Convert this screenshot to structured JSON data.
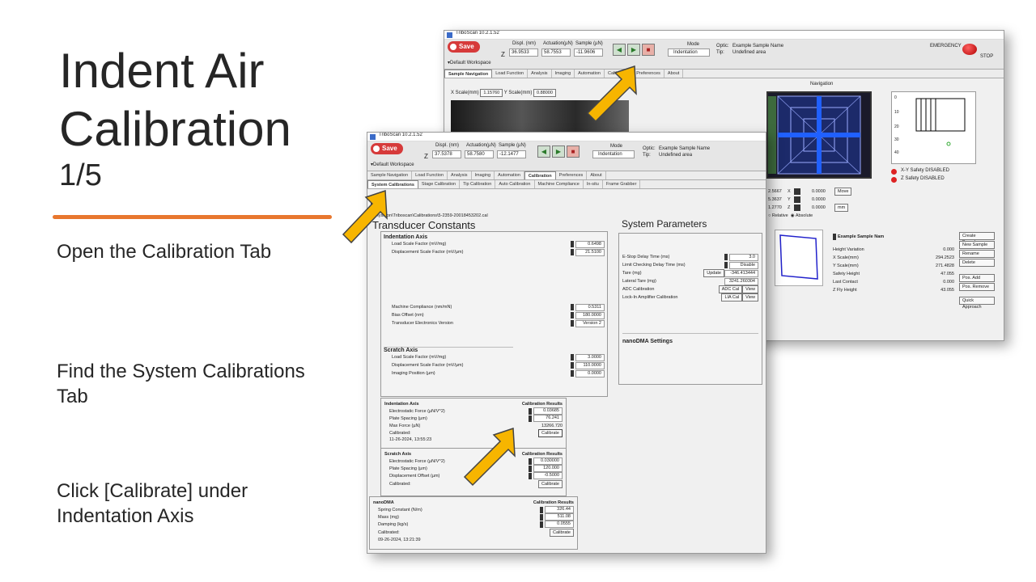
{
  "slide": {
    "title_line1": "Indent Air",
    "title_line2": "Calibration",
    "step": "1/5",
    "instructions": [
      "Open the Calibration Tab",
      "Find the System Calibrations Tab",
      "Click [Calibrate] under Indentation Axis"
    ],
    "accent_color": "#e8772e"
  },
  "back_window": {
    "app_title": "TriboScan 10.2.1.52",
    "save_label": "Save",
    "z_label": "Z",
    "displ_label": "Displ. (nm)",
    "displ_value": "36.9533",
    "actuation_label": "Actuation(µN)",
    "actuation_value": "58.7553",
    "sample_label": "Sample (µN)",
    "sample_value": "-11.9606",
    "mode_label": "Mode",
    "mode_value": "Indentation",
    "optic_label": "Optic:",
    "optic_value": "Example Sample Name",
    "tip_label": "Tip:",
    "tip_value": "Undefined area",
    "emergency_label": "EMERGENCY",
    "stop_label": "STOP",
    "workspace": "Default Workspace",
    "tabs": [
      "Sample Navigation",
      "Load Function",
      "Analysis",
      "Imaging",
      "Automation",
      "Calibration",
      "Preferences",
      "About"
    ],
    "xscale_label": "X Scale(mm)",
    "xscale_value": "1.15760",
    "yscale_label": "Y Scale(mm)",
    "yscale_value": "0.88000",
    "navigation_label": "Navigation",
    "xy_safety": "X-Y Safety DISABLED",
    "z_safety": "Z  Safety DISABLED",
    "y_ticks": [
      "0",
      "10",
      "20",
      "30",
      "40"
    ],
    "coords": [
      {
        "label": "X",
        "left": "2.5667",
        "right": "0.0000",
        "btn": "Move"
      },
      {
        "label": "Y",
        "left": "5.3637",
        "right": "0.0000",
        "btn": ""
      },
      {
        "label": "Z",
        "left": "1.2770",
        "right": "0.0000",
        "btn": "mm"
      }
    ],
    "relative_label": "Relative",
    "absolute_label": "Absolute",
    "sample_name": "Example Sample Nam",
    "sample_fields": [
      {
        "label": "Height Variation",
        "value": "0.000"
      },
      {
        "label": "X Scale(mm)",
        "value": "294.2523"
      },
      {
        "label": "Y Scale(mm)",
        "value": "271.4828"
      },
      {
        "label": "Safety Height",
        "value": "47.055"
      },
      {
        "label": "Last Contact",
        "value": "0.000"
      },
      {
        "label": "Z Fly Height",
        "value": "43.055"
      }
    ],
    "sample_buttons": [
      "Create Boundary",
      "New Sample",
      "Rename",
      "Delete",
      "Pos. Add",
      "Pos. Remove",
      "Quick Approach"
    ]
  },
  "front_window": {
    "app_title": "TriboScan 10.2.1.52",
    "save_label": "Save",
    "z_label": "Z",
    "displ_label": "Displ. (nm)",
    "displ_value": "37.5378",
    "actuation_label": "Actuation(µN)",
    "actuation_value": "58.7580",
    "sample_label": "Sample (µN)",
    "sample_value": "-12.1477",
    "mode_label": "Mode",
    "mode_value": "Indentation",
    "optic_label": "Optic:",
    "optic_value": "Example Sample Name",
    "tip_label": "Tip:",
    "tip_value": "Undefined area",
    "workspace": "Default Workspace",
    "tabs": [
      "Sample Navigation",
      "Load Function",
      "Analysis",
      "Imaging",
      "Automation",
      "Calibration",
      "Preferences",
      "About"
    ],
    "subtabs": [
      "System Calibrations",
      "Stage Calibration",
      "Tip Calibration",
      "Auto Calibration",
      "Machine Compliance",
      "In-situ",
      "Frame Grabber"
    ],
    "path": "c:\\Hysitron\\Triboscan\\Calibrations\\5-2359-20018453202.cal",
    "transducer_title": "Transducer Constants",
    "indentation_axis": {
      "title": "Indentation Axis",
      "rows": [
        {
          "label": "Load Scale Factor  (mV/mg)",
          "value": "0.6498"
        },
        {
          "label": "Displacement Scale Factor (mV/µm)",
          "value": "21.5100"
        }
      ],
      "rows2": [
        {
          "label": "Machine Compliance (nm/mN)",
          "value": "0.5311"
        },
        {
          "label": "Bias Offset (nm)",
          "value": "180.0000"
        },
        {
          "label": "Transducer Electronics Version",
          "value": "Version 2"
        }
      ]
    },
    "scratch_axis": {
      "title": "Scratch Axis",
      "rows": [
        {
          "label": "Load Scale Factor  (mV/mg)",
          "value": "3.0000"
        },
        {
          "label": "Displacement Scale Factor (mV/µm)",
          "value": "110.0000"
        },
        {
          "label": "Imaging Position (µm)",
          "value": "0.0000"
        }
      ]
    },
    "cal_indent": {
      "title": "Indentation Axis",
      "results": "Calibration Results",
      "rows": [
        {
          "label": "Electrostatic Force (µN/V^2)",
          "value": "0.03685"
        },
        {
          "label": "Plate Spacing (µm)",
          "value": "76.241"
        },
        {
          "label": "Max Force (µN)",
          "value": "13266.720"
        }
      ],
      "calibrated_label": "Calibrated:",
      "calibrated_date": "11-26-2024, 13:55:23",
      "button": "Calibrate"
    },
    "cal_scratch": {
      "title": "Scratch Axis",
      "results": "Calibration Results",
      "rows": [
        {
          "label": "Electrostatic Force (µN/V^2)",
          "value": "0.030000"
        },
        {
          "label": "Plate Spacing (µm)",
          "value": "120.000"
        },
        {
          "label": "Displacement Offset (µm)",
          "value": "-0.5000"
        }
      ],
      "calibrated_label": "Calibrated:",
      "button": "Calibrate"
    },
    "cal_nanodma": {
      "title": "nanoDMA",
      "results": "Calibration Results",
      "rows": [
        {
          "label": "Spring Constant (N/m)",
          "value": "326.44"
        },
        {
          "label": "Mass (mg)",
          "value": "511.08"
        },
        {
          "label": "Damping (kg/s)",
          "value": "0.0555"
        }
      ],
      "calibrated_label": "Calibrated:",
      "calibrated_date": "09-26-2024, 13:21:39",
      "button": "Calibrate"
    },
    "system_params": {
      "title": "System Parameters",
      "rows": [
        {
          "label": "E-Stop Delay Time (ms)",
          "value": "3.0"
        },
        {
          "label": "Limit Checking Delay Time (ms)",
          "value": "Disable"
        },
        {
          "label": "Tare (mg)",
          "value": "-346.413444",
          "btn": "Update"
        },
        {
          "label": "Lateral Tare (mg)",
          "value": "3241.260304"
        }
      ],
      "adc_label": "ADC Calibration",
      "adc_btn": "ADC Cal",
      "lia_label": "Lock-In Amplifier Calibration",
      "lia_btn": "LIA Cal",
      "view_label": "View",
      "nanodma_settings": "nanoDMA Settings"
    }
  }
}
